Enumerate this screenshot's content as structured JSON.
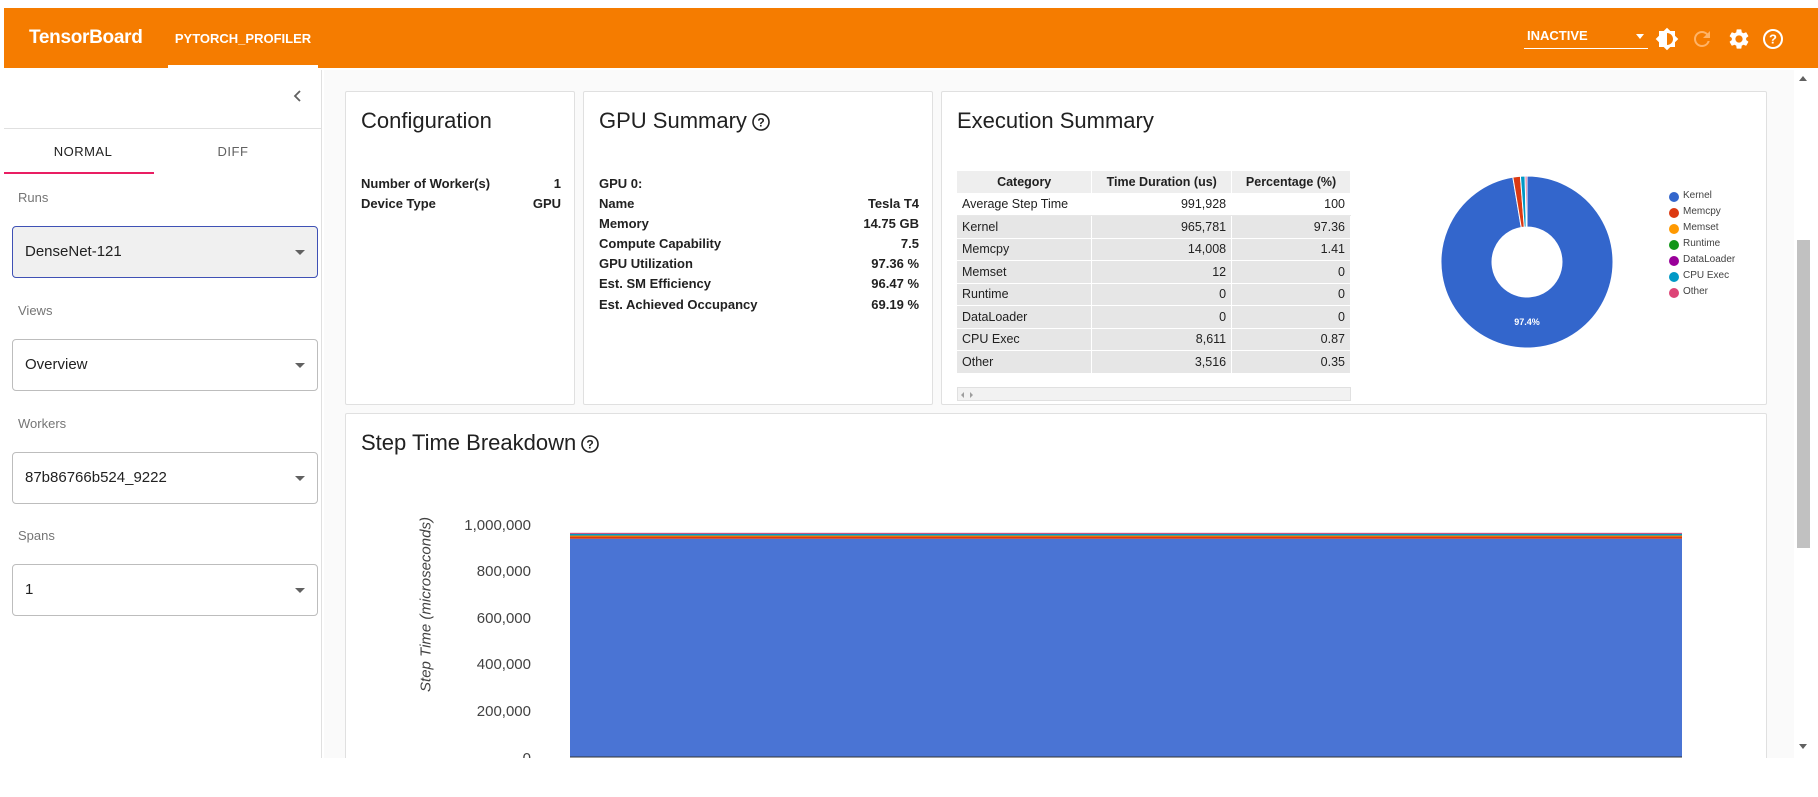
{
  "app": {
    "brand": "TensorBoard",
    "active_plugin": "PYTORCH_PROFILER",
    "status_select": "INACTIVE",
    "accent_color": "#f57c00"
  },
  "sidebar": {
    "tabs": [
      {
        "label": "NORMAL",
        "active": true
      },
      {
        "label": "DIFF",
        "active": false
      }
    ],
    "fields": [
      {
        "label": "Runs",
        "value": "DenseNet-121"
      },
      {
        "label": "Views",
        "value": "Overview"
      },
      {
        "label": "Workers",
        "value": "87b86766b524_9222"
      },
      {
        "label": "Spans",
        "value": "1"
      }
    ]
  },
  "configuration": {
    "title": "Configuration",
    "rows": [
      {
        "key": "Number of Worker(s)",
        "value": "1"
      },
      {
        "key": "Device Type",
        "value": "GPU"
      }
    ]
  },
  "gpu_summary": {
    "title": "GPU Summary",
    "gpu_label": "GPU 0:",
    "rows": [
      {
        "key": "Name",
        "value": "Tesla T4"
      },
      {
        "key": "Memory",
        "value": "14.75 GB"
      },
      {
        "key": "Compute Capability",
        "value": "7.5"
      },
      {
        "key": "GPU Utilization",
        "value": "97.36 %"
      },
      {
        "key": "Est. SM Efficiency",
        "value": "96.47 %"
      },
      {
        "key": "Est. Achieved Occupancy",
        "value": "69.19 %"
      }
    ]
  },
  "execution_summary": {
    "title": "Execution Summary",
    "columns": [
      "Category",
      "Time Duration (us)",
      "Percentage (%)"
    ],
    "rows": [
      [
        "Average Step Time",
        "991,928",
        "100"
      ],
      [
        "Kernel",
        "965,781",
        "97.36"
      ],
      [
        "Memcpy",
        "14,008",
        "1.41"
      ],
      [
        "Memset",
        "12",
        "0"
      ],
      [
        "Runtime",
        "0",
        "0"
      ],
      [
        "DataLoader",
        "0",
        "0"
      ],
      [
        "CPU Exec",
        "8,611",
        "0.87"
      ],
      [
        "Other",
        "3,516",
        "0.35"
      ]
    ],
    "pie_label": "97.4%",
    "legend": [
      {
        "name": "Kernel",
        "color": "#3366cc"
      },
      {
        "name": "Memcpy",
        "color": "#dc3912"
      },
      {
        "name": "Memset",
        "color": "#ff9900"
      },
      {
        "name": "Runtime",
        "color": "#109618"
      },
      {
        "name": "DataLoader",
        "color": "#990099"
      },
      {
        "name": "CPU Exec",
        "color": "#0099c6"
      },
      {
        "name": "Other",
        "color": "#dd4477"
      }
    ]
  },
  "step_time": {
    "title": "Step Time Breakdown",
    "ylabel": "Step Time (microseconds)",
    "yticks": [
      "1,000,000",
      "800,000",
      "600,000",
      "400,000",
      "200,000",
      "0"
    ]
  },
  "chart_data": [
    {
      "type": "pie",
      "labels": [
        "Kernel",
        "Memcpy",
        "Memset",
        "Runtime",
        "DataLoader",
        "CPU Exec",
        "Other"
      ],
      "values": [
        97.36,
        1.41,
        0,
        0,
        0,
        0.87,
        0.35
      ],
      "colors": [
        "#3366cc",
        "#dc3912",
        "#ff9900",
        "#109618",
        "#990099",
        "#0099c6",
        "#dd4477"
      ],
      "donut": true,
      "slice_label": "97.4%",
      "legend_position": "right"
    },
    {
      "type": "area",
      "title": "Step Time Breakdown",
      "ylabel": "Step Time (microseconds)",
      "ylim": [
        0,
        1000000
      ],
      "stacked": true,
      "series": [
        {
          "name": "Kernel",
          "values": [
            965781,
            965781
          ],
          "color": "#4a74d4"
        },
        {
          "name": "Memcpy",
          "values": [
            14008,
            14008
          ],
          "color": "#dc3912"
        },
        {
          "name": "Memset",
          "values": [
            12,
            12
          ],
          "color": "#ff9900"
        },
        {
          "name": "Runtime",
          "values": [
            0,
            0
          ],
          "color": "#109618"
        },
        {
          "name": "DataLoader",
          "values": [
            0,
            0
          ],
          "color": "#990099"
        },
        {
          "name": "CPU Exec",
          "values": [
            8611,
            8611
          ],
          "color": "#0099c6"
        },
        {
          "name": "Other",
          "values": [
            3516,
            3516
          ],
          "color": "#dd4477"
        }
      ]
    }
  ]
}
